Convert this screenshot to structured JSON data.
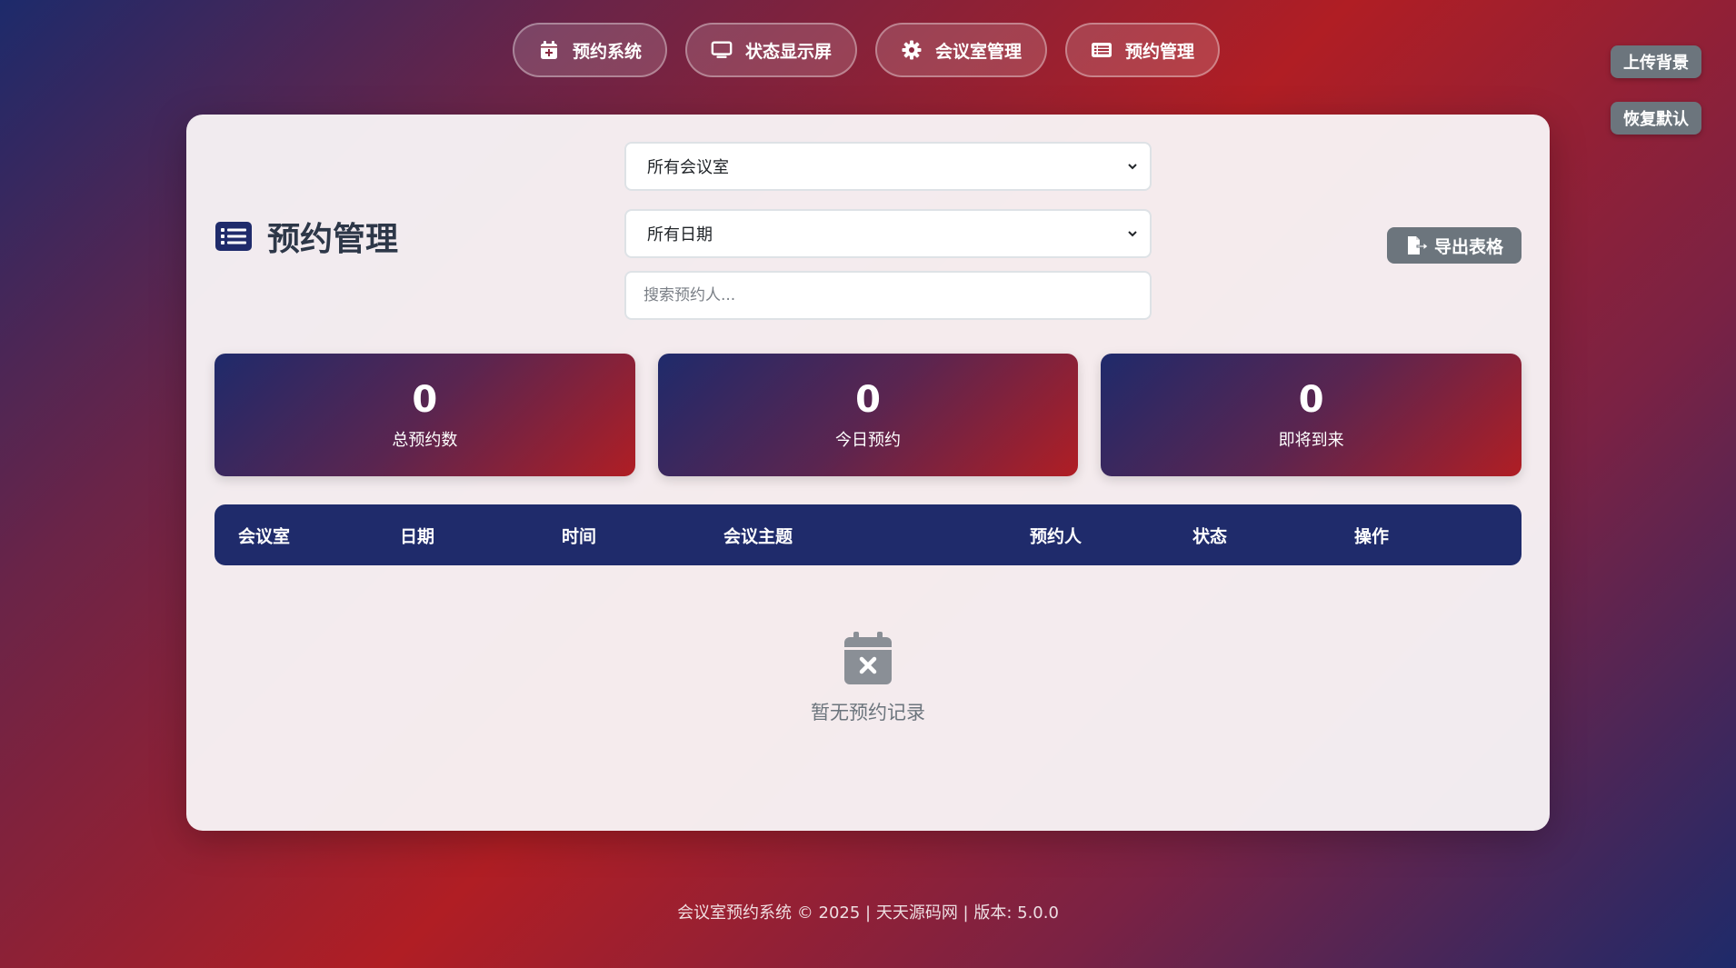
{
  "nav": {
    "items": [
      {
        "label": "预约系统",
        "icon": "calendar-plus-icon"
      },
      {
        "label": "状态显示屏",
        "icon": "monitor-icon"
      },
      {
        "label": "会议室管理",
        "icon": "gear-icon"
      },
      {
        "label": "预约管理",
        "icon": "list-icon"
      }
    ]
  },
  "side_buttons": {
    "upload_bg": "上传背景",
    "restore_default": "恢复默认"
  },
  "page": {
    "title": "预约管理",
    "title_icon": "list-icon"
  },
  "filters": {
    "room_select": "所有会议室",
    "date_select": "所有日期",
    "search_placeholder": "搜索预约人..."
  },
  "export": {
    "label": "导出表格",
    "icon": "export-file-icon"
  },
  "stats": [
    {
      "value": "0",
      "label": "总预约数"
    },
    {
      "value": "0",
      "label": "今日预约"
    },
    {
      "value": "0",
      "label": "即将到来"
    }
  ],
  "table": {
    "headers": [
      "会议室",
      "日期",
      "时间",
      "会议主题",
      "预约人",
      "状态",
      "操作"
    ]
  },
  "empty_state": {
    "icon": "calendar-x-icon",
    "text": "暂无预约记录"
  },
  "footer": {
    "text": "会议室预约系统 © 2025 | 天天源码网 | 版本: 5.0.0"
  },
  "colors": {
    "primary_navy": "#1f2b6b",
    "accent_red": "#b01e24",
    "button_gray": "#6c757d"
  }
}
